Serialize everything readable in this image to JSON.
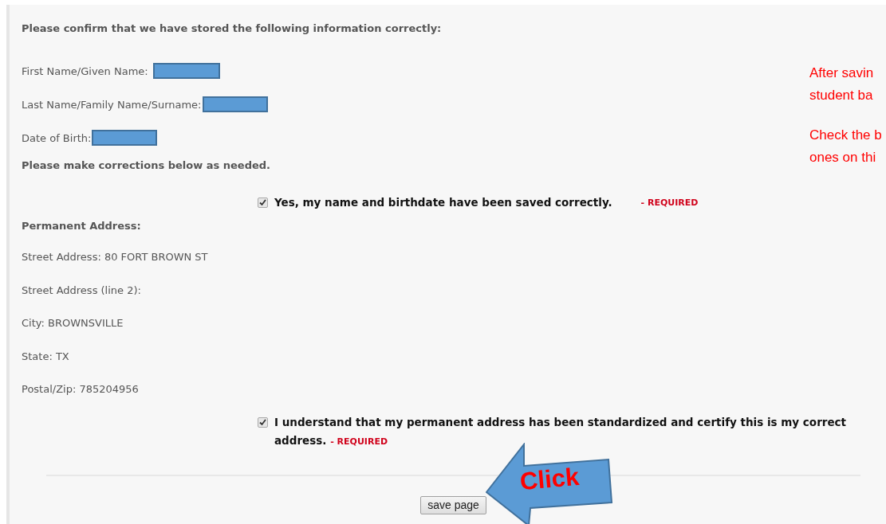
{
  "heading": "Please confirm that we have stored the following information correctly:",
  "identity_fields": [
    {
      "label": "First Name/Given Name:"
    },
    {
      "label": "Last Name/Family Name/Surname:"
    },
    {
      "label": "Date of Birth:"
    }
  ],
  "corrections_note": "Please make corrections below as needed.",
  "name_confirm": {
    "label": "Yes, my name and birthdate have been saved correctly.",
    "required": "- REQUIRED",
    "checked": true
  },
  "address_heading": "Permanent Address:",
  "address_fields": [
    "Street Address: 80 FORT BROWN ST",
    "Street Address (line 2):",
    "City: BROWNSVILLE",
    "State: TX",
    "Postal/Zip: 785204956"
  ],
  "address_confirm": {
    "label": "I understand that my permanent address has been standardized and certify this is my correct address.",
    "required": "- REQUIRED",
    "checked": true
  },
  "save_button": "save page",
  "callout": {
    "text": "Click"
  },
  "notes": [
    [
      "After savin",
      "student ba"
    ],
    [
      "Check the b",
      "ones on thi"
    ]
  ]
}
